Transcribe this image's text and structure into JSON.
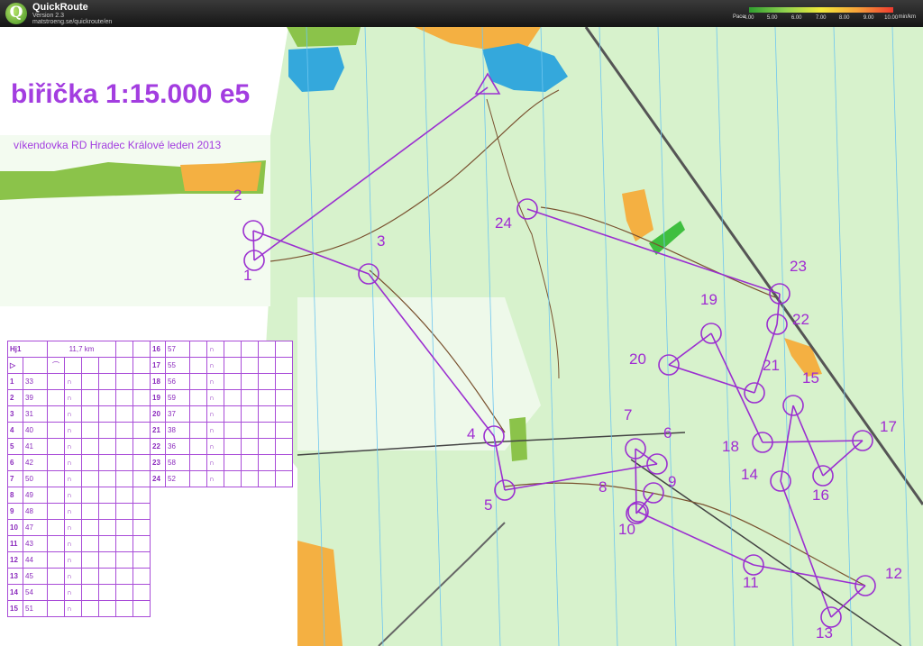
{
  "app": {
    "name": "QuickRoute",
    "version": "Version 2.3",
    "url": "matstroeng.se/quickroute/en",
    "logo_letter": "Q"
  },
  "pace_legend": {
    "title": "Pace",
    "ticks": [
      "4.00",
      "5.00",
      "6.00",
      "7.00",
      "8.00",
      "9.00",
      "10.00"
    ],
    "unit": "min/km"
  },
  "map": {
    "title": "biřička 1:15.000 e5",
    "subtitle": "víkendovka RD Hradec Králové leden 2013",
    "colors": {
      "course": "#9b2fd0",
      "forest": "#ccefc1",
      "water": "#34a8dc",
      "track": "#6b4a2a",
      "road": "#555555"
    }
  },
  "controls": [
    {
      "num": "1"
    },
    {
      "num": "2"
    },
    {
      "num": "3"
    },
    {
      "num": "4"
    },
    {
      "num": "5"
    },
    {
      "num": "6"
    },
    {
      "num": "7"
    },
    {
      "num": "8"
    },
    {
      "num": "9"
    },
    {
      "num": "10"
    },
    {
      "num": "11"
    },
    {
      "num": "12"
    },
    {
      "num": "13"
    },
    {
      "num": "14"
    },
    {
      "num": "15"
    },
    {
      "num": "16"
    },
    {
      "num": "17"
    },
    {
      "num": "18"
    },
    {
      "num": "19"
    },
    {
      "num": "20"
    },
    {
      "num": "21"
    },
    {
      "num": "22"
    },
    {
      "num": "23"
    },
    {
      "num": "24"
    }
  ],
  "description_sheet": {
    "course": "Hj1",
    "length": "11,7 km",
    "rows_left": [
      {
        "n": "1",
        "code": "33"
      },
      {
        "n": "2",
        "code": "39"
      },
      {
        "n": "3",
        "code": "31"
      },
      {
        "n": "4",
        "code": "40"
      },
      {
        "n": "5",
        "code": "41"
      },
      {
        "n": "6",
        "code": "42"
      },
      {
        "n": "7",
        "code": "50"
      },
      {
        "n": "8",
        "code": "49"
      },
      {
        "n": "9",
        "code": "48"
      },
      {
        "n": "10",
        "code": "47"
      },
      {
        "n": "11",
        "code": "43"
      },
      {
        "n": "12",
        "code": "44"
      },
      {
        "n": "13",
        "code": "45"
      },
      {
        "n": "14",
        "code": "54"
      },
      {
        "n": "15",
        "code": "51"
      }
    ],
    "rows_right": [
      {
        "n": "16",
        "code": "57"
      },
      {
        "n": "17",
        "code": "55"
      },
      {
        "n": "18",
        "code": "56"
      },
      {
        "n": "19",
        "code": "59"
      },
      {
        "n": "20",
        "code": "37"
      },
      {
        "n": "21",
        "code": "38"
      },
      {
        "n": "22",
        "code": "36"
      },
      {
        "n": "23",
        "code": "58"
      },
      {
        "n": "24",
        "code": "52"
      }
    ]
  }
}
